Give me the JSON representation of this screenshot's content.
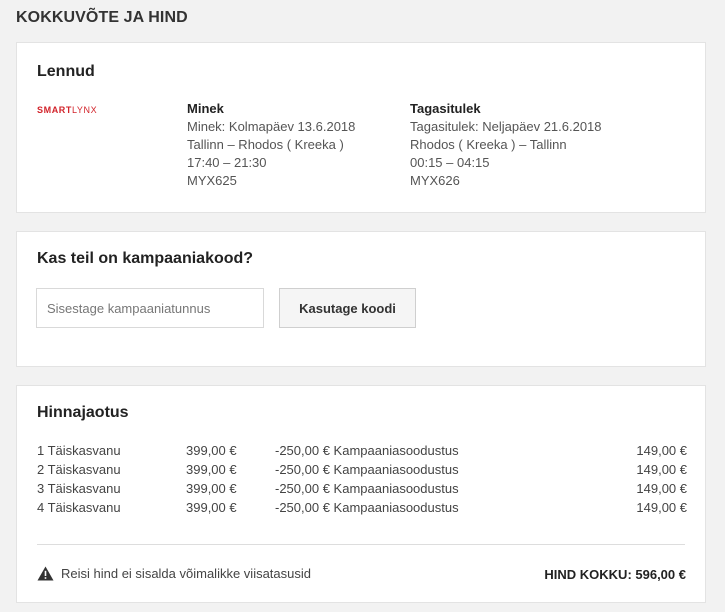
{
  "page": {
    "heading": "KOKKUVÕTE JA HIND"
  },
  "flights": {
    "title": "Lennud",
    "airline_logo": {
      "part1": "SMART",
      "part2": "LYNX",
      "color": "#d2232a"
    },
    "outbound": {
      "title": "Minek",
      "date": "Minek: Kolmapäev 13.6.2018",
      "route": "Tallinn – Rhodos ( Kreeka )",
      "time": "17:40 – 21:30",
      "flight_number": "MYX625"
    },
    "return": {
      "title": "Tagasitulek",
      "date": "Tagasitulek: Neljapäev 21.6.2018",
      "route": "Rhodos ( Kreeka ) – Tallinn",
      "time": "00:15 – 04:15",
      "flight_number": "MYX626"
    }
  },
  "promo": {
    "title": "Kas teil on kampaaniakood?",
    "input_placeholder": "Sisestage kampaaniatunnus",
    "input_value": "",
    "button_label": "Kasutage koodi"
  },
  "price": {
    "title": "Hinnajaotus",
    "rows": [
      {
        "passenger": "1 Täiskasvanu",
        "price": "399,00 €",
        "discount": "-250,00 € Kampaaniasoodustus",
        "total": "149,00 €"
      },
      {
        "passenger": "2 Täiskasvanu",
        "price": "399,00 €",
        "discount": "-250,00 € Kampaaniasoodustus",
        "total": "149,00 €"
      },
      {
        "passenger": "3 Täiskasvanu",
        "price": "399,00 €",
        "discount": "-250,00 € Kampaaniasoodustus",
        "total": "149,00 €"
      },
      {
        "passenger": "4 Täiskasvanu",
        "price": "399,00 €",
        "discount": "-250,00 € Kampaaniasoodustus",
        "total": "149,00 €"
      }
    ],
    "note_icon": "warning-icon",
    "note": "Reisi hind ei sisalda võimalikke viisatasusid",
    "grand_total": "HIND KOKKU: 596,00 €"
  }
}
